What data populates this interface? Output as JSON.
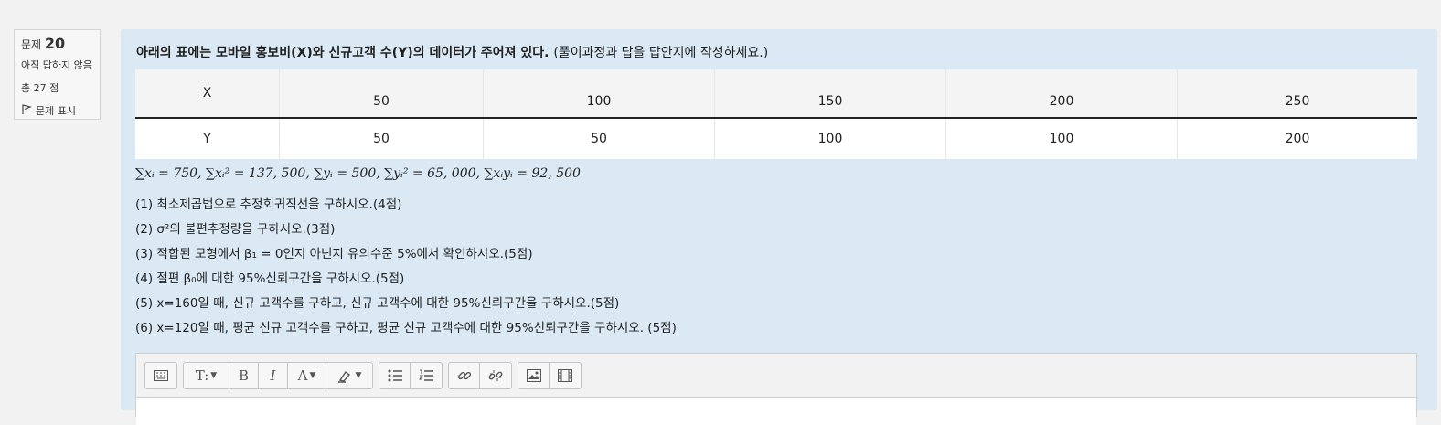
{
  "question_info": {
    "label": "문제",
    "number": "20",
    "status": "아직 답하지 않음",
    "points": "총 27 점",
    "flag_label": "문제 표시"
  },
  "question": {
    "text": "아래의 표에는 모바일 홍보비(X)와 신규고객 수(Y)의 데이터가 주어져 있다.",
    "note": "(풀이과정과 답을 답안지에 작성하세요.)"
  },
  "table": {
    "x_label": "X",
    "x_values": [
      "50",
      "100",
      "150",
      "200",
      "250"
    ],
    "y_label": "Y",
    "y_values": [
      "50",
      "50",
      "100",
      "100",
      "200"
    ]
  },
  "formula": "∑xᵢ = 750,  ∑xᵢ² = 137, 500,  ∑yᵢ = 500,  ∑yᵢ² = 65, 000,  ∑xᵢyᵢ = 92, 500",
  "items": [
    "(1) 최소제곱법으로 추정회귀직선을 구하시오.(4점)",
    "(2) σ²의 불편추정량을 구하시오.(3점)",
    "(3) 적합된 모형에서 β₁ = 0인지 아닌지 유의수준 5%에서 확인하시오.(5점)",
    "(4) 절편 β₀에 대한 95%신뢰구간을 구하시오.(5점)",
    "(5) x=160일 때, 신규 고객수를 구하고, 신규 고객수에 대한 95%신뢰구간을 구하시오.(5점)",
    "(6) x=120일 때, 평균 신규 고객수를 구하고, 평균 신규 고객수에 대한 95%신뢰구간을 구하시오. (5점)"
  ],
  "toolbar": {
    "paragraph_label": "T:",
    "bold_label": "B",
    "italic_label": "I",
    "font_color_label": "A",
    "icons": [
      "toolbar-toggle-icon",
      "paragraph-style-icon",
      "bold-icon",
      "italic-icon",
      "font-color-icon",
      "highlight-icon",
      "bullet-list-icon",
      "numbered-list-icon",
      "link-icon",
      "unlink-icon",
      "image-icon",
      "media-icon"
    ]
  }
}
